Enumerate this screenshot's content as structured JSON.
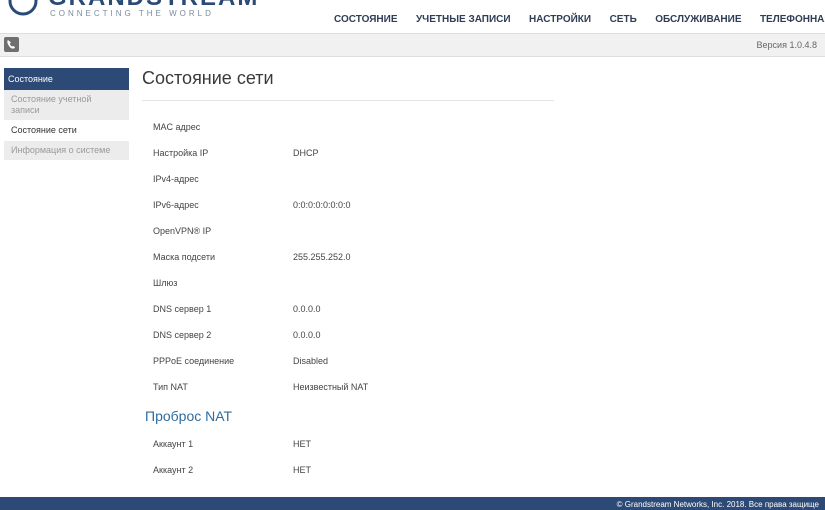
{
  "header": {
    "logo_text": "GRANDSTREAM",
    "logo_tagline": "CONNECTING THE WORLD",
    "nav": [
      "СОСТОЯНИЕ",
      "УЧЕТНЫЕ ЗАПИСИ",
      "НАСТРОЙКИ",
      "СЕТЬ",
      "ОБСЛУЖИВАНИЕ",
      "ТЕЛЕФОННАЯ КНИ"
    ]
  },
  "toolbar": {
    "version": "Версия 1.0.4.8"
  },
  "sidebar": {
    "header": "Состояние",
    "items": [
      {
        "label": "Состояние учетной записи"
      },
      {
        "label": "Состояние сети"
      },
      {
        "label": "Информация о системе"
      }
    ]
  },
  "main": {
    "title": "Состояние сети",
    "rows": [
      {
        "label": "MAC адрес",
        "value": ""
      },
      {
        "label": "Настройка IP",
        "value": "DHCP"
      },
      {
        "label": "IPv4-адрес",
        "value": ""
      },
      {
        "label": "IPv6-адрес",
        "value": "0:0:0:0:0:0:0:0"
      },
      {
        "label": "OpenVPN® IP",
        "value": ""
      },
      {
        "label": "Маска подсети",
        "value": "255.255.252.0"
      },
      {
        "label": "Шлюз",
        "value": ""
      },
      {
        "label": "DNS сервер 1",
        "value": "0.0.0.0"
      },
      {
        "label": "DNS сервер 2",
        "value": "0.0.0.0"
      },
      {
        "label": "PPPoE соединение",
        "value": "Disabled"
      },
      {
        "label": "Тип NAT",
        "value": "Неизвестный NAT"
      }
    ],
    "nat_section_title": "Проброс NAT",
    "nat_rows": [
      {
        "label": "Аккаунт 1",
        "value": "НЕТ"
      },
      {
        "label": "Аккаунт 2",
        "value": "НЕТ"
      }
    ]
  },
  "footer": {
    "copyright": "© Grandstream Networks, Inc. 2018. Все права защище"
  },
  "colors": {
    "brand": "#2c4a75",
    "section": "#2f6c9e"
  }
}
